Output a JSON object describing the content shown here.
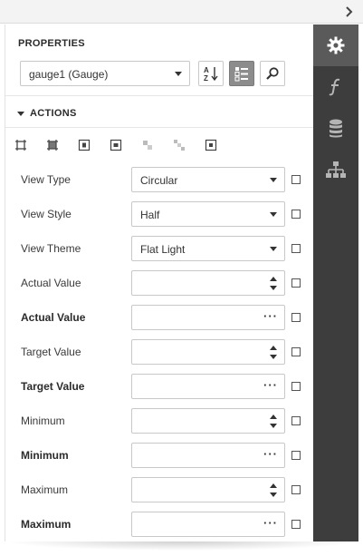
{
  "panel": {
    "title": "PROPERTIES",
    "selector_value": "gauge1 (Gauge)",
    "section_title": "ACTIONS"
  },
  "toolbar": {
    "sort_icon": "sort-alphabetical-icon",
    "categorized_icon": "categorized-view-icon",
    "search_icon": "search-icon",
    "categorized_pressed": true
  },
  "actions": [
    {
      "icon": "fit-bounds-icon"
    },
    {
      "icon": "fit-whole-icon"
    },
    {
      "icon": "center-horizontally-icon"
    },
    {
      "icon": "center-vertically-icon"
    },
    {
      "icon": "align-disabled-icon"
    },
    {
      "icon": "distribute-disabled-icon"
    },
    {
      "icon": "center-in-parent-icon"
    }
  ],
  "properties": [
    {
      "label": "View Type",
      "bold": false,
      "editor": "dropdown",
      "value": "Circular"
    },
    {
      "label": "View Style",
      "bold": false,
      "editor": "dropdown",
      "value": "Half"
    },
    {
      "label": "View Theme",
      "bold": false,
      "editor": "dropdown",
      "value": "Flat Light"
    },
    {
      "label": "Actual Value",
      "bold": false,
      "editor": "spin",
      "value": ""
    },
    {
      "label": "Actual Value",
      "bold": true,
      "editor": "ellipsis",
      "value": ""
    },
    {
      "label": "Target Value",
      "bold": false,
      "editor": "spin",
      "value": ""
    },
    {
      "label": "Target Value",
      "bold": true,
      "editor": "ellipsis",
      "value": ""
    },
    {
      "label": "Minimum",
      "bold": false,
      "editor": "spin",
      "value": ""
    },
    {
      "label": "Minimum",
      "bold": true,
      "editor": "ellipsis",
      "value": ""
    },
    {
      "label": "Maximum",
      "bold": false,
      "editor": "spin",
      "value": ""
    },
    {
      "label": "Maximum",
      "bold": true,
      "editor": "ellipsis",
      "value": ""
    }
  ],
  "ellipsis_text": "···",
  "rail": [
    {
      "icon": "gear-icon",
      "active": true
    },
    {
      "icon": "function-icon",
      "active": false
    },
    {
      "icon": "database-icon",
      "active": false
    },
    {
      "icon": "hierarchy-icon",
      "active": false
    }
  ],
  "colors": {
    "rail_bg": "#3d3d3d",
    "rail_active": "#5a5a5a",
    "pressed_button": "#8c8c8c"
  }
}
